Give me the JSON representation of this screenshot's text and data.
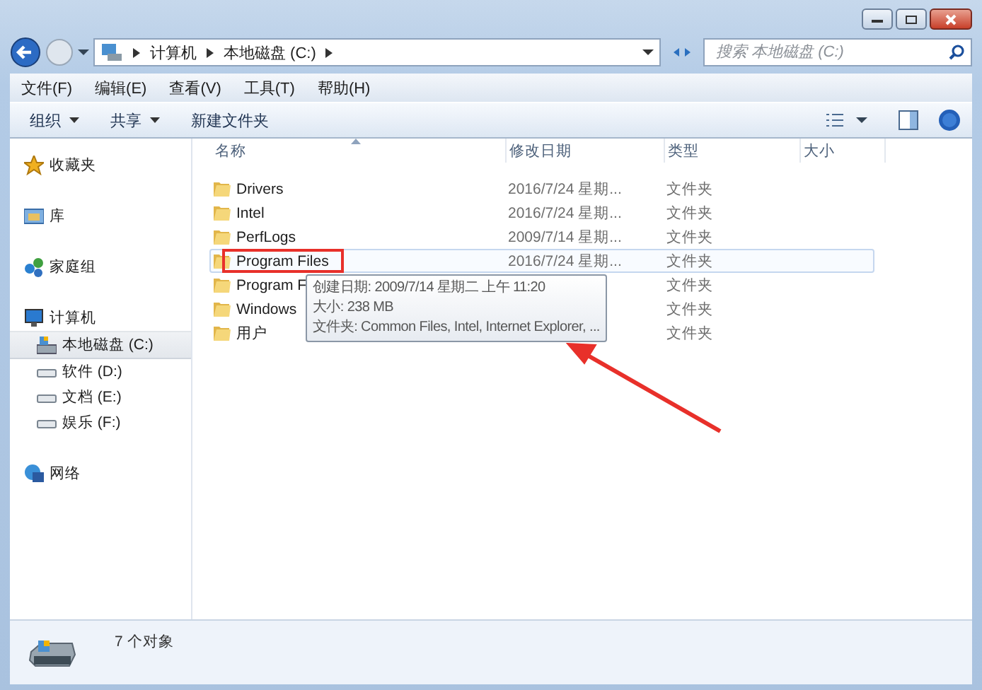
{
  "address": {
    "crumbs": [
      "计算机",
      "本地磁盘 (C:)"
    ]
  },
  "search": {
    "placeholder": "搜索 本地磁盘 (C:)"
  },
  "menu": [
    "文件(F)",
    "编辑(E)",
    "查看(V)",
    "工具(T)",
    "帮助(H)"
  ],
  "commands": [
    {
      "label": "组织",
      "dropdown": true
    },
    {
      "label": "共享",
      "dropdown": true
    },
    {
      "label": "新建文件夹",
      "dropdown": false
    }
  ],
  "sidebar": {
    "items": [
      {
        "label": "收藏夹",
        "kind": "star",
        "selected": false
      },
      {
        "label": "库",
        "kind": "library",
        "selected": false
      },
      {
        "label": "家庭组",
        "kind": "homegroup",
        "selected": false
      },
      {
        "label": "计算机",
        "kind": "computer",
        "selected": false,
        "children": [
          {
            "label": "本地磁盘 (C:)",
            "kind": "sysdrive",
            "selected": true
          },
          {
            "label": "软件 (D:)",
            "kind": "drive",
            "selected": false
          },
          {
            "label": "文档 (E:)",
            "kind": "drive",
            "selected": false
          },
          {
            "label": "娱乐 (F:)",
            "kind": "drive",
            "selected": false
          }
        ]
      },
      {
        "label": "网络",
        "kind": "network",
        "selected": false
      }
    ]
  },
  "table": {
    "columns": [
      "名称",
      "修改日期",
      "类型",
      "大小"
    ],
    "rows": [
      {
        "name": "Drivers",
        "date": "2016/7/24 星期...",
        "type": "文件夹",
        "hovered": false
      },
      {
        "name": "Intel",
        "date": "2016/7/24 星期...",
        "type": "文件夹",
        "hovered": false
      },
      {
        "name": "PerfLogs",
        "date": "2009/7/14 星期...",
        "type": "文件夹",
        "hovered": false
      },
      {
        "name": "Program Files",
        "date": "2016/7/24 星期...",
        "type": "文件夹",
        "hovered": true
      },
      {
        "name": "Program F",
        "type": "文件夹",
        "hovered": false
      },
      {
        "name": "Windows",
        "type": "文件夹",
        "hovered": false
      },
      {
        "name": "用户",
        "type": "文件夹",
        "hovered": false
      }
    ]
  },
  "tooltip": {
    "lines": [
      "创建日期: 2009/7/14 星期二 上午 11:20",
      "大小: 238 MB",
      "文件夹: Common Files, Intel, Internet Explorer, ..."
    ]
  },
  "annotation": {
    "color": "#e8302a"
  },
  "status_bar": {
    "text": "7 个对象"
  }
}
